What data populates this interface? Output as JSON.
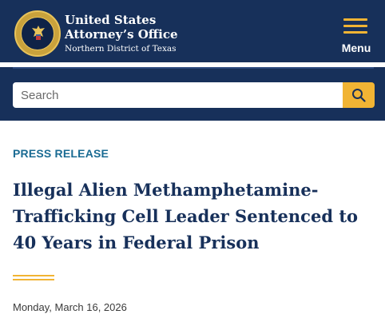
{
  "header": {
    "title_line1": "United States",
    "title_line2": "Attorney’s Office",
    "subtitle": "Northern District of Texas",
    "menu_label": "Menu",
    "seal_icon": "doj-seal-icon",
    "menu_icon": "hamburger-icon"
  },
  "search": {
    "placeholder": "Search",
    "value": "",
    "button_icon": "search-icon"
  },
  "article": {
    "category": "PRESS RELEASE",
    "title": "Illegal Alien Methamphetamine-Trafficking Cell Leader Sentenced to 40 Years in Federal Prison",
    "date": "Monday, March 16, 2026"
  },
  "colors": {
    "navy": "#17305a",
    "gold": "#f1b434",
    "category_blue": "#1a6b93"
  }
}
